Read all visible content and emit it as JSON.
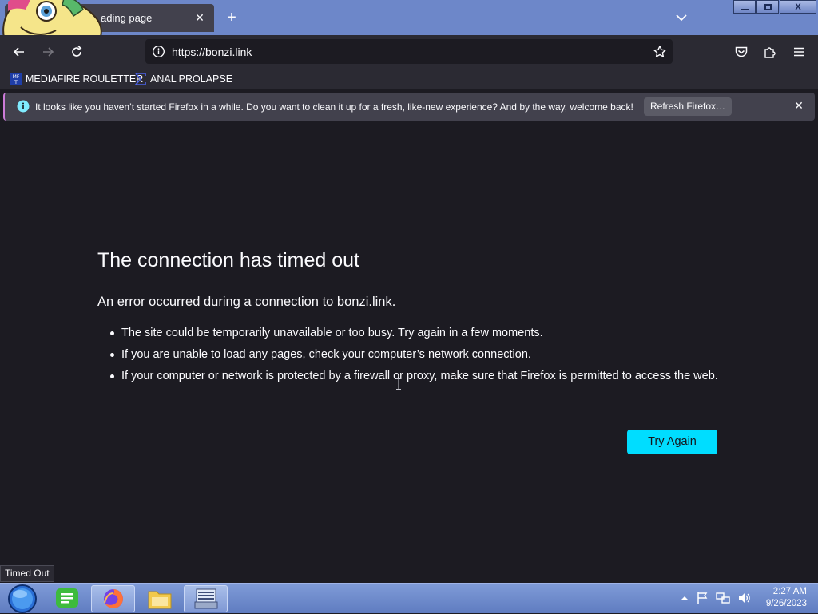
{
  "window": {
    "tab_title": "Loading page",
    "tab_title_visible": "ading page",
    "minimize_label": "",
    "restore_label": "",
    "close_label": "X"
  },
  "navbar": {
    "url_value": "https://bonzi.link",
    "url_scheme": "https://",
    "url_host": "bonzi.link"
  },
  "bookmarks": [
    {
      "label": "MEDIAFIRE ROULETTER",
      "icon": "mediafire-icon"
    },
    {
      "label": "ANAL PROLAPSE",
      "icon": "sigma-icon"
    }
  ],
  "notification": {
    "text": "It looks like you haven’t started Firefox in a while. Do you want to clean it up for a fresh, like-new experience? And by the way, welcome back!",
    "button_label": "Refresh Firefox…"
  },
  "error_page": {
    "title": "The connection has timed out",
    "description": "An error occurred during a connection to bonzi.link.",
    "bullets": [
      "The site could be temporarily unavailable or too busy. Try again in a few moments.",
      "If you are unable to load any pages, check your computer’s network connection.",
      "If your computer or network is protected by a firewall or proxy, make sure that Firefox is permitted to access the web."
    ],
    "try_again_label": "Try Again"
  },
  "status_bar": {
    "text": "Timed Out"
  },
  "taskbar": {
    "apps": [
      "start-orb-icon",
      "notes-app-icon",
      "firefox-icon",
      "file-explorer-icon",
      "on-screen-keyboard-icon"
    ],
    "time": "2:27 AM",
    "date": "9/26/2023"
  },
  "colors": {
    "titlebar": "#6d87c9",
    "toolbar": "#2b2a33",
    "content_bg": "#1c1b22",
    "accent_button": "#00ddff",
    "notification_bg": "#42414d"
  }
}
